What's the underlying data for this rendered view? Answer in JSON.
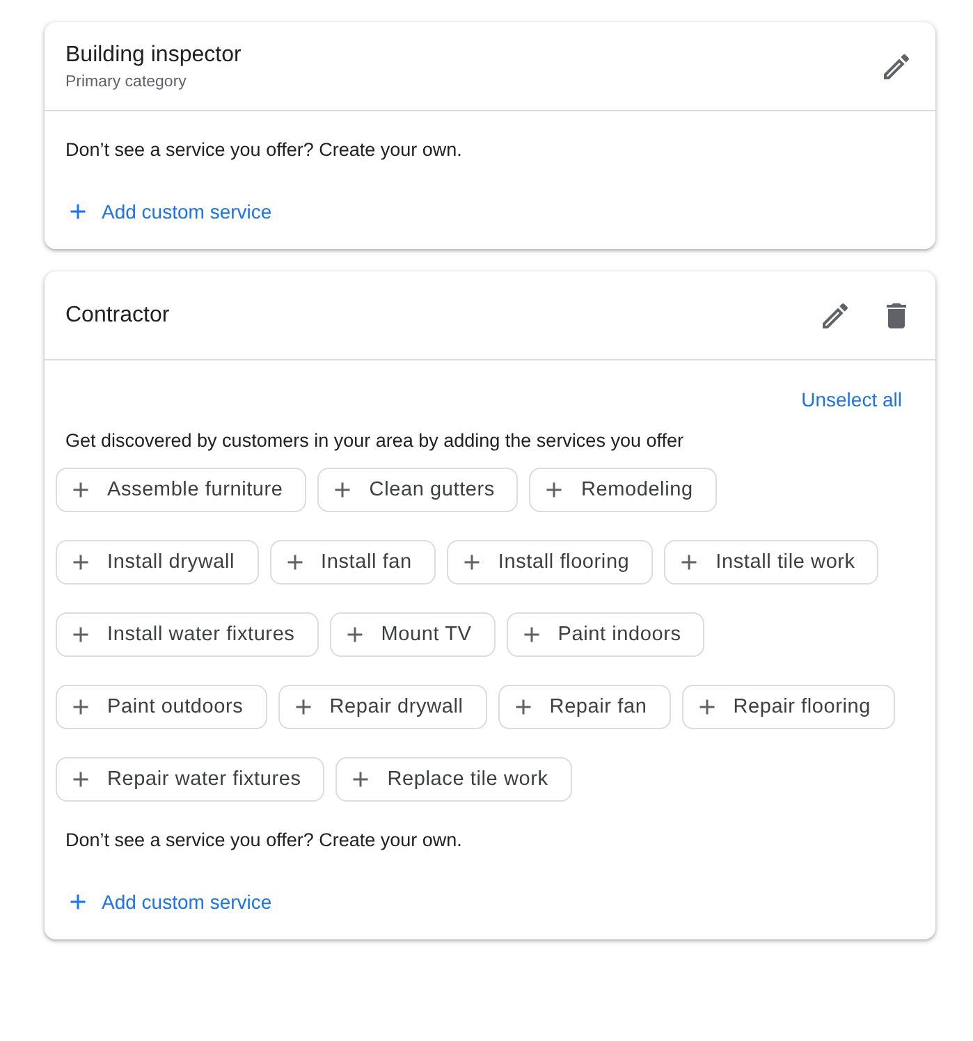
{
  "categories": [
    {
      "title": "Building inspector",
      "subtitle": "Primary category",
      "deletable": false,
      "custom_hint": "Don’t see a service you offer? Create your own.",
      "add_custom": "Add custom service"
    },
    {
      "title": "Contractor",
      "deletable": true,
      "unselect_all": "Unselect all",
      "intro": "Get discovered by customers in your area by adding the services you offer",
      "services": [
        {
          "label": "Assemble furniture",
          "selected": false
        },
        {
          "label": "Clean gutters",
          "selected": false
        },
        {
          "label": "Remodeling",
          "selected": false
        },
        {
          "label": "Install drywall",
          "selected": false
        },
        {
          "label": "Install fan",
          "selected": false
        },
        {
          "label": "Install flooring",
          "selected": false
        },
        {
          "label": "Install tile work",
          "selected": false
        },
        {
          "label": "Install water fixtures",
          "selected": false
        },
        {
          "label": "Mount TV",
          "selected": false
        },
        {
          "label": "Paint indoors",
          "selected": false
        },
        {
          "label": "Paint outdoors",
          "selected": false
        },
        {
          "label": "Repair drywall",
          "selected": false
        },
        {
          "label": "Repair fan",
          "selected": false
        },
        {
          "label": "Repair flooring",
          "selected": false
        },
        {
          "label": "Repair water fixtures",
          "selected": false
        },
        {
          "label": "Replace tile work",
          "selected": false
        }
      ],
      "custom_hint": "Don’t see a service you offer? Create your own.",
      "add_custom": "Add custom service"
    }
  ]
}
